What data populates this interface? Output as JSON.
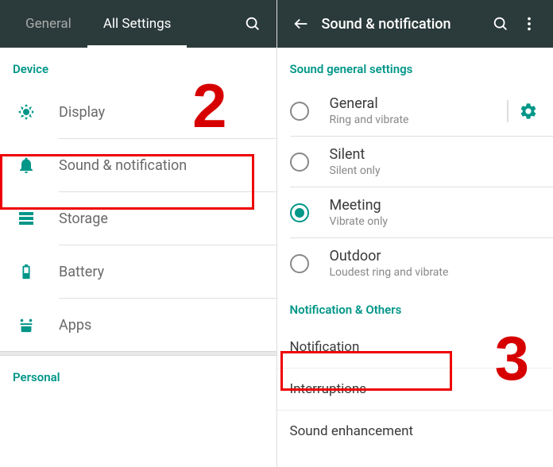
{
  "left": {
    "tabs": {
      "general": "General",
      "all": "All Settings"
    },
    "sections": {
      "device": "Device",
      "personal": "Personal"
    },
    "items": {
      "display": "Display",
      "sound": "Sound & notification",
      "storage": "Storage",
      "battery": "Battery",
      "apps": "Apps"
    },
    "step_num": "2"
  },
  "right": {
    "title": "Sound & notification",
    "sections": {
      "general": "Sound general settings",
      "notif_others": "Notification & Others"
    },
    "profiles": {
      "general": {
        "title": "General",
        "sub": "Ring and vibrate"
      },
      "silent": {
        "title": "Silent",
        "sub": "Silent only"
      },
      "meeting": {
        "title": "Meeting",
        "sub": "Vibrate only"
      },
      "outdoor": {
        "title": "Outdoor",
        "sub": "Loudest ring and vibrate"
      }
    },
    "items": {
      "notification": "Notification",
      "interruptions": "Interruptions",
      "sound_enhancement": "Sound enhancement"
    },
    "step_num": "3"
  }
}
